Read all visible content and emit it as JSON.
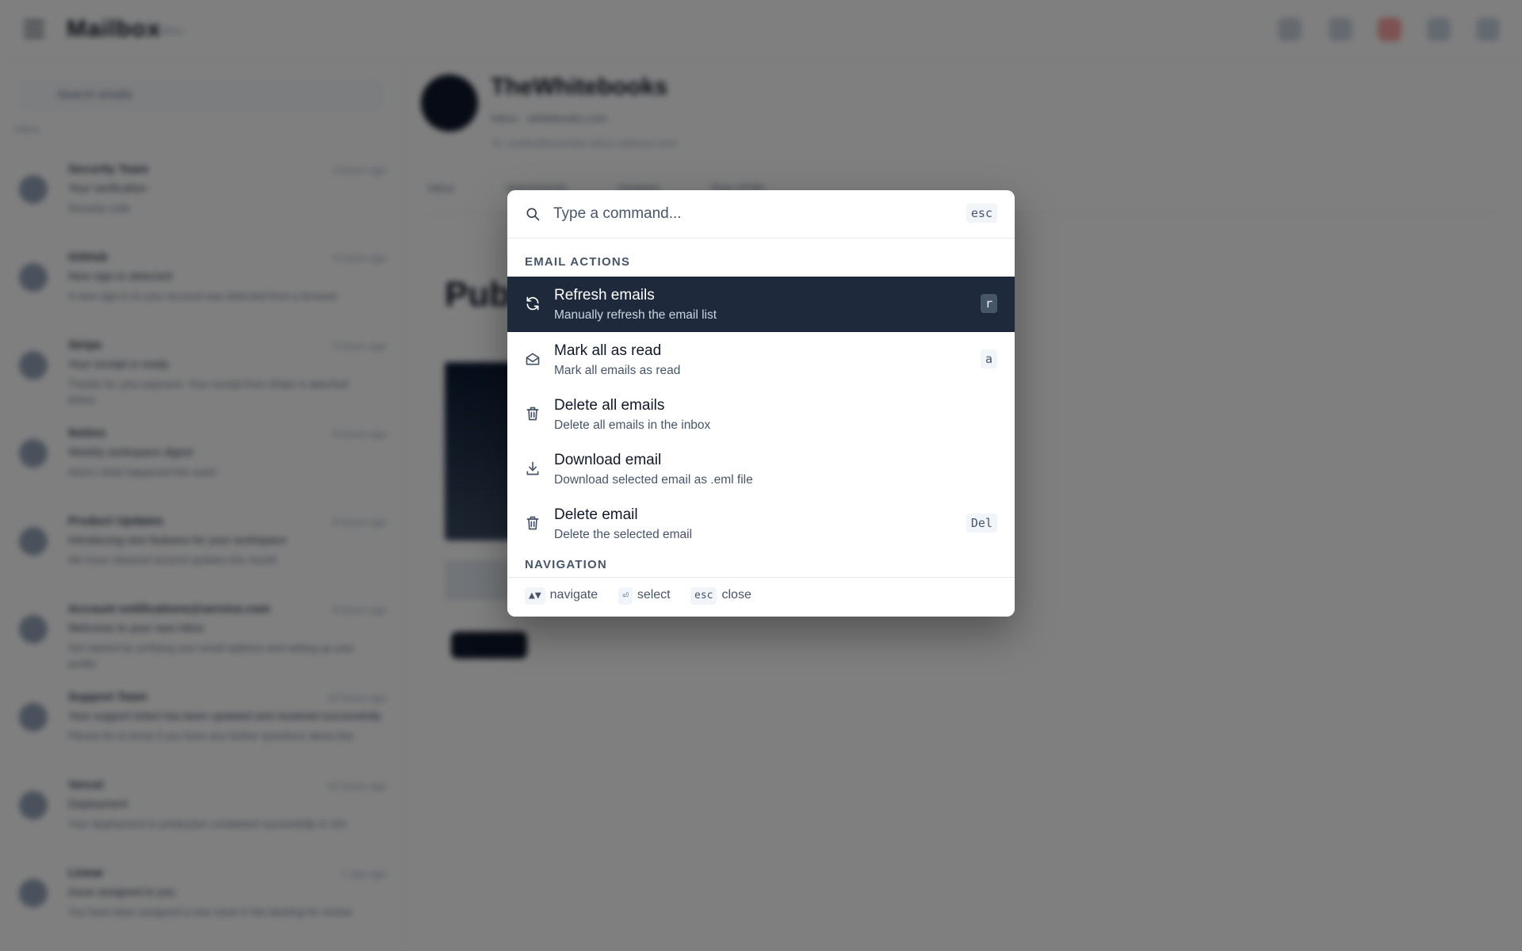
{
  "app": {
    "brand": "Mailbox",
    "brand_sub": "inbox",
    "search_placeholder": "Search emails",
    "section_label": "Inbox",
    "emails": [
      {
        "from": "Security Team",
        "when": "2 hours ago",
        "subject": "Your verification",
        "preview": "Security code"
      },
      {
        "from": "GitHub",
        "when": "3 hours ago",
        "subject": "New sign-in detected",
        "preview": "A new sign-in to your account was detected from a browser"
      },
      {
        "from": "Stripe",
        "when": "5 hours ago",
        "subject": "Your receipt is ready",
        "preview": "Thanks for your payment. Your receipt from Stripe is attached below"
      },
      {
        "from": "Notion",
        "when": "6 hours ago",
        "subject": "Weekly workspace digest",
        "preview": "Here's what happened this week"
      },
      {
        "from": "Product Updates",
        "when": "8 hours ago",
        "subject": "Introducing new features for your workspace",
        "preview": "We have released several updates this month"
      },
      {
        "from": "Account notifications@service.com",
        "when": "9 hours ago",
        "subject": "Welcome to your new inbox",
        "preview": "Get started by verifying your email address and setting up your profile"
      },
      {
        "from": "Support Team",
        "when": "10 hours ago",
        "subject": "Your support ticket has been updated and resolved successfully",
        "preview": "Please let us know if you have any further questions about this"
      },
      {
        "from": "Vercel",
        "when": "12 hours ago",
        "subject": "Deployment",
        "preview": "Your deployment to production completed successfully in 42s"
      },
      {
        "from": "Linear",
        "when": "1 day ago",
        "subject": "Issue assigned to you",
        "preview": "You have been assigned a new issue in the backlog for review"
      }
    ],
    "viewer": {
      "name": "TheWhitebooks",
      "meta": "Inbox · whitebooks.com",
      "meta2": "To: reader@example-inbox-address.com",
      "tabs": [
        "Inbox",
        "Attachments",
        "Headers",
        "Raw HTML"
      ],
      "hero_title": "Pub"
    }
  },
  "palette": {
    "search_placeholder": "Type a command...",
    "esc_key": "esc",
    "groups": [
      {
        "label": "EMAIL ACTIONS",
        "items": [
          {
            "title": "Refresh emails",
            "description": "Manually refresh the email list",
            "shortcut": "r",
            "icon": "refresh-icon",
            "active": true
          },
          {
            "title": "Mark all as read",
            "description": "Mark all emails as read",
            "shortcut": "a",
            "icon": "mail-open-icon",
            "active": false
          },
          {
            "title": "Delete all emails",
            "description": "Delete all emails in the inbox",
            "shortcut": "",
            "icon": "trash-icon",
            "active": false
          },
          {
            "title": "Download email",
            "description": "Download selected email as .eml file",
            "shortcut": "",
            "icon": "download-icon",
            "active": false
          },
          {
            "title": "Delete email",
            "description": "Delete the selected email",
            "shortcut": "Del",
            "icon": "trash-icon",
            "active": false
          }
        ]
      },
      {
        "label": "NAVIGATION",
        "items": []
      }
    ],
    "footer": {
      "navigate_key": "▲▼",
      "navigate_label": "navigate",
      "select_key": "⏎",
      "select_label": "select",
      "close_key": "esc",
      "close_label": "close"
    }
  },
  "colors": {
    "overlay": "#000000",
    "active_row": "#1e293b",
    "accent_red": "#ef4444"
  }
}
